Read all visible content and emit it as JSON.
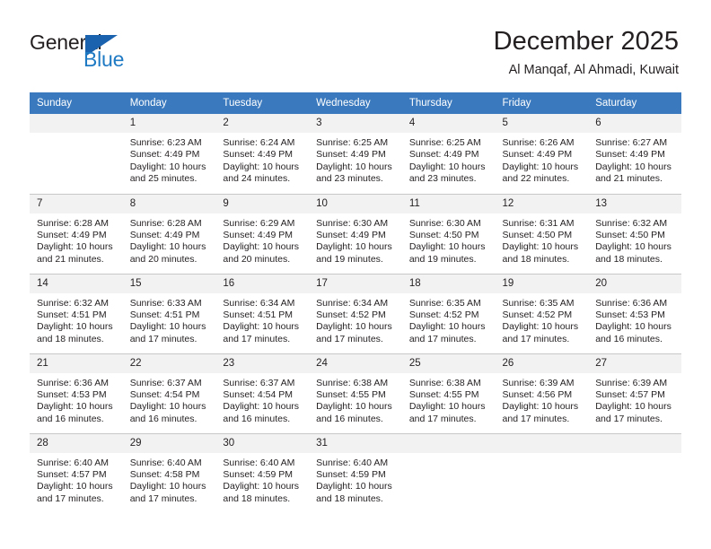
{
  "logo": {
    "word_top": "General",
    "word_bottom": "Blue",
    "triangle_icon": "triangle-icon",
    "colors": {
      "general": "#231f20",
      "blue": "#1f7ac4",
      "triangle": "#1a62ad"
    }
  },
  "header": {
    "title": "December 2025",
    "subtitle": "Al Manqaf, Al Ahmadi, Kuwait"
  },
  "theme": {
    "header_bar": "#3a79bd",
    "daynum_band": "#f2f2f2",
    "grid_line": "#c8c8c8",
    "text": "#231f20"
  },
  "weekdays": [
    "Sunday",
    "Monday",
    "Tuesday",
    "Wednesday",
    "Thursday",
    "Friday",
    "Saturday"
  ],
  "weeks": [
    [
      {
        "day": "",
        "sunrise": "",
        "sunset": "",
        "daylight": "",
        "empty": true
      },
      {
        "day": "1",
        "sunrise": "Sunrise: 6:23 AM",
        "sunset": "Sunset: 4:49 PM",
        "daylight": "Daylight: 10 hours and 25 minutes."
      },
      {
        "day": "2",
        "sunrise": "Sunrise: 6:24 AM",
        "sunset": "Sunset: 4:49 PM",
        "daylight": "Daylight: 10 hours and 24 minutes."
      },
      {
        "day": "3",
        "sunrise": "Sunrise: 6:25 AM",
        "sunset": "Sunset: 4:49 PM",
        "daylight": "Daylight: 10 hours and 23 minutes."
      },
      {
        "day": "4",
        "sunrise": "Sunrise: 6:25 AM",
        "sunset": "Sunset: 4:49 PM",
        "daylight": "Daylight: 10 hours and 23 minutes."
      },
      {
        "day": "5",
        "sunrise": "Sunrise: 6:26 AM",
        "sunset": "Sunset: 4:49 PM",
        "daylight": "Daylight: 10 hours and 22 minutes."
      },
      {
        "day": "6",
        "sunrise": "Sunrise: 6:27 AM",
        "sunset": "Sunset: 4:49 PM",
        "daylight": "Daylight: 10 hours and 21 minutes."
      }
    ],
    [
      {
        "day": "7",
        "sunrise": "Sunrise: 6:28 AM",
        "sunset": "Sunset: 4:49 PM",
        "daylight": "Daylight: 10 hours and 21 minutes."
      },
      {
        "day": "8",
        "sunrise": "Sunrise: 6:28 AM",
        "sunset": "Sunset: 4:49 PM",
        "daylight": "Daylight: 10 hours and 20 minutes."
      },
      {
        "day": "9",
        "sunrise": "Sunrise: 6:29 AM",
        "sunset": "Sunset: 4:49 PM",
        "daylight": "Daylight: 10 hours and 20 minutes."
      },
      {
        "day": "10",
        "sunrise": "Sunrise: 6:30 AM",
        "sunset": "Sunset: 4:49 PM",
        "daylight": "Daylight: 10 hours and 19 minutes."
      },
      {
        "day": "11",
        "sunrise": "Sunrise: 6:30 AM",
        "sunset": "Sunset: 4:50 PM",
        "daylight": "Daylight: 10 hours and 19 minutes."
      },
      {
        "day": "12",
        "sunrise": "Sunrise: 6:31 AM",
        "sunset": "Sunset: 4:50 PM",
        "daylight": "Daylight: 10 hours and 18 minutes."
      },
      {
        "day": "13",
        "sunrise": "Sunrise: 6:32 AM",
        "sunset": "Sunset: 4:50 PM",
        "daylight": "Daylight: 10 hours and 18 minutes."
      }
    ],
    [
      {
        "day": "14",
        "sunrise": "Sunrise: 6:32 AM",
        "sunset": "Sunset: 4:51 PM",
        "daylight": "Daylight: 10 hours and 18 minutes."
      },
      {
        "day": "15",
        "sunrise": "Sunrise: 6:33 AM",
        "sunset": "Sunset: 4:51 PM",
        "daylight": "Daylight: 10 hours and 17 minutes."
      },
      {
        "day": "16",
        "sunrise": "Sunrise: 6:34 AM",
        "sunset": "Sunset: 4:51 PM",
        "daylight": "Daylight: 10 hours and 17 minutes."
      },
      {
        "day": "17",
        "sunrise": "Sunrise: 6:34 AM",
        "sunset": "Sunset: 4:52 PM",
        "daylight": "Daylight: 10 hours and 17 minutes."
      },
      {
        "day": "18",
        "sunrise": "Sunrise: 6:35 AM",
        "sunset": "Sunset: 4:52 PM",
        "daylight": "Daylight: 10 hours and 17 minutes."
      },
      {
        "day": "19",
        "sunrise": "Sunrise: 6:35 AM",
        "sunset": "Sunset: 4:52 PM",
        "daylight": "Daylight: 10 hours and 17 minutes."
      },
      {
        "day": "20",
        "sunrise": "Sunrise: 6:36 AM",
        "sunset": "Sunset: 4:53 PM",
        "daylight": "Daylight: 10 hours and 16 minutes."
      }
    ],
    [
      {
        "day": "21",
        "sunrise": "Sunrise: 6:36 AM",
        "sunset": "Sunset: 4:53 PM",
        "daylight": "Daylight: 10 hours and 16 minutes."
      },
      {
        "day": "22",
        "sunrise": "Sunrise: 6:37 AM",
        "sunset": "Sunset: 4:54 PM",
        "daylight": "Daylight: 10 hours and 16 minutes."
      },
      {
        "day": "23",
        "sunrise": "Sunrise: 6:37 AM",
        "sunset": "Sunset: 4:54 PM",
        "daylight": "Daylight: 10 hours and 16 minutes."
      },
      {
        "day": "24",
        "sunrise": "Sunrise: 6:38 AM",
        "sunset": "Sunset: 4:55 PM",
        "daylight": "Daylight: 10 hours and 16 minutes."
      },
      {
        "day": "25",
        "sunrise": "Sunrise: 6:38 AM",
        "sunset": "Sunset: 4:55 PM",
        "daylight": "Daylight: 10 hours and 17 minutes."
      },
      {
        "day": "26",
        "sunrise": "Sunrise: 6:39 AM",
        "sunset": "Sunset: 4:56 PM",
        "daylight": "Daylight: 10 hours and 17 minutes."
      },
      {
        "day": "27",
        "sunrise": "Sunrise: 6:39 AM",
        "sunset": "Sunset: 4:57 PM",
        "daylight": "Daylight: 10 hours and 17 minutes."
      }
    ],
    [
      {
        "day": "28",
        "sunrise": "Sunrise: 6:40 AM",
        "sunset": "Sunset: 4:57 PM",
        "daylight": "Daylight: 10 hours and 17 minutes."
      },
      {
        "day": "29",
        "sunrise": "Sunrise: 6:40 AM",
        "sunset": "Sunset: 4:58 PM",
        "daylight": "Daylight: 10 hours and 17 minutes."
      },
      {
        "day": "30",
        "sunrise": "Sunrise: 6:40 AM",
        "sunset": "Sunset: 4:59 PM",
        "daylight": "Daylight: 10 hours and 18 minutes."
      },
      {
        "day": "31",
        "sunrise": "Sunrise: 6:40 AM",
        "sunset": "Sunset: 4:59 PM",
        "daylight": "Daylight: 10 hours and 18 minutes."
      },
      {
        "day": "",
        "sunrise": "",
        "sunset": "",
        "daylight": "",
        "empty": true
      },
      {
        "day": "",
        "sunrise": "",
        "sunset": "",
        "daylight": "",
        "empty": true
      },
      {
        "day": "",
        "sunrise": "",
        "sunset": "",
        "daylight": "",
        "empty": true
      }
    ]
  ]
}
